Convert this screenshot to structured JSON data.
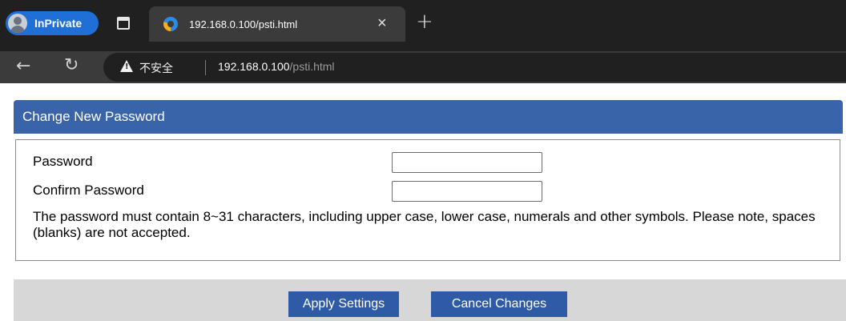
{
  "browser": {
    "inprivate_label": "InPrivate",
    "tab_title": "192.168.0.100/psti.html",
    "tab_close_glyph": "×",
    "new_tab_glyph": "+",
    "back_glyph": "←",
    "refresh_glyph": "↻",
    "security_text": "不安全",
    "url_host": "192.168.0.100",
    "url_path": "/psti.html",
    "icons": [
      "avatar-icon",
      "tab-actions-icon",
      "favicon-icon",
      "close-icon",
      "plus-icon",
      "back-arrow-icon",
      "refresh-icon",
      "warning-icon"
    ]
  },
  "page": {
    "section_title": "Change New Password",
    "fields": [
      {
        "label": "Password",
        "value": "",
        "placeholder": ""
      },
      {
        "label": "Confirm Password",
        "value": "",
        "placeholder": ""
      }
    ],
    "help_text": "The password must contain 8~31 characters, including upper case, lower case, numerals and other symbols. Please note, spaces (blanks) are not accepted.",
    "buttons": {
      "apply": "Apply Settings",
      "cancel": "Cancel Changes"
    }
  },
  "colors": {
    "header_blue": "#3a64aa",
    "button_blue": "#2f5aa5",
    "action_bar_gray": "#d7d7d7",
    "inprivate_blue": "#1f6fd6"
  }
}
